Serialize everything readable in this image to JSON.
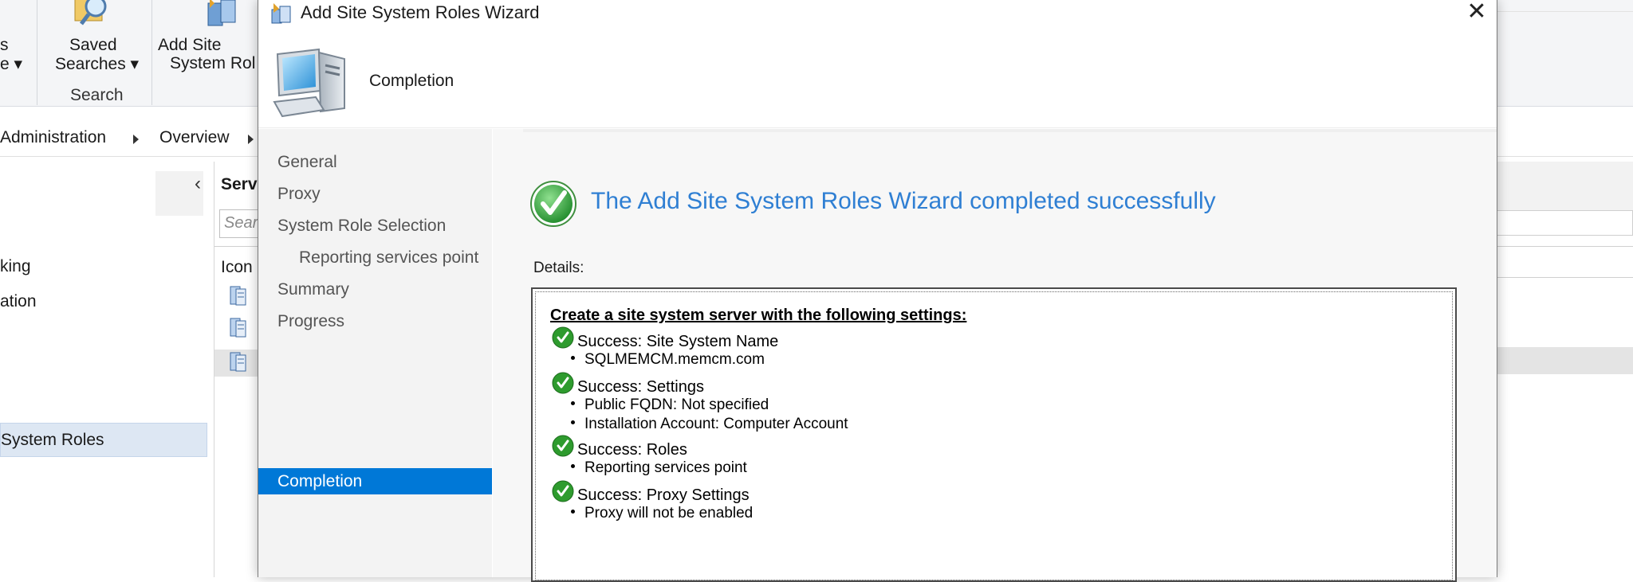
{
  "ribbon": {
    "partial_left_top": "s",
    "partial_left_bottom": "e ▾",
    "saved_searches_line1": "Saved",
    "saved_searches_line2": "Searches ▾",
    "search_group": "Search",
    "add_site_line1": "Add Site",
    "add_site_line2": "System Rol"
  },
  "breadcrumb": {
    "item1": "Administration",
    "item2": "Overview"
  },
  "navpane": {
    "collapse_glyph": "‹",
    "item_partial1": "king",
    "item_partial2": "ation",
    "selected_item": "System Roles"
  },
  "listpane": {
    "header_partial": "Serv",
    "search_placeholder": "Sear",
    "column_icon": "Icon"
  },
  "dialog": {
    "title": "Add Site System Roles Wizard",
    "close_glyph": "✕",
    "header_title": "Completion",
    "steps": [
      {
        "label": "General"
      },
      {
        "label": "Proxy"
      },
      {
        "label": "System Role Selection"
      },
      {
        "label": "Reporting services point"
      },
      {
        "label": "Summary"
      },
      {
        "label": "Progress"
      },
      {
        "label": "Completion"
      }
    ],
    "success_message": "The Add Site System Roles Wizard completed successfully",
    "details_label": "Details:",
    "details": {
      "heading": "Create a site system server with the following settings:",
      "sections": [
        {
          "title": "Success: Site System Name",
          "bullets": [
            "SQLMEMCM.memcm.com"
          ]
        },
        {
          "title": "Success: Settings",
          "bullets": [
            "Public FQDN: Not specified",
            "Installation Account: Computer Account"
          ]
        },
        {
          "title": "Success: Roles",
          "bullets": [
            "Reporting services point"
          ]
        },
        {
          "title": "Success: Proxy Settings",
          "bullets": [
            "Proxy will not be enabled"
          ]
        }
      ]
    }
  },
  "colors": {
    "accent": "#0078d7",
    "success_text": "#2f7fd3",
    "success_green": "#2e9b2e"
  },
  "icons": [
    "wizard-icon",
    "computer-icon",
    "success-check-icon",
    "saved-searches-icon",
    "add-site-role-icon",
    "server-icon"
  ]
}
